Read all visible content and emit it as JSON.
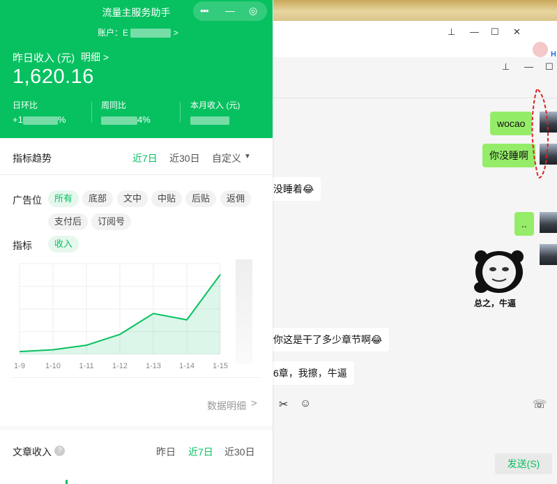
{
  "assistant": {
    "title": "流量主服务助手",
    "capsule": {
      "more": "•••",
      "minimize": "—",
      "close": "◎"
    },
    "account_label": "账户：",
    "account_first_char": "E",
    "chevron": ">",
    "yesterday_income_label": "昨日收入 (元)",
    "detail_link": "明细 >",
    "yesterday_income_value": "1,620.16",
    "stats": [
      {
        "label": "日环比",
        "value_prefix": "+1",
        "value_suffix": "%"
      },
      {
        "label": "周同比",
        "value_prefix": "",
        "value_suffix": "4%"
      },
      {
        "label": "本月收入 (元)",
        "value_prefix": "",
        "value_suffix": ""
      }
    ],
    "trend": {
      "title": "指标趋势",
      "tabs": [
        "近7日",
        "近30日",
        "自定义"
      ],
      "active_tab": "近7日",
      "dropdown_icon": "▼"
    },
    "ad_slot": {
      "label": "广告位",
      "options": [
        "所有",
        "底部",
        "文中",
        "中贴",
        "后贴",
        "返佣",
        "支付后",
        "订阅号"
      ],
      "active": "所有"
    },
    "metric": {
      "label": "指标",
      "options": [
        "收入"
      ],
      "active": "收入"
    },
    "data_detail_link": "数据明细",
    "article_income": {
      "title": "文章收入",
      "help_icon": "?",
      "tabs": [
        "昨日",
        "近7日",
        "近30日"
      ],
      "active_tab": "近7日"
    },
    "accent_color": "#07c160"
  },
  "chart_data": {
    "type": "area",
    "x": [
      "1-9",
      "1-10",
      "1-11",
      "1-12",
      "1-13",
      "1-14",
      "1-15"
    ],
    "series": [
      {
        "values": [
          0.03,
          0.05,
          0.1,
          0.22,
          0.45,
          0.38,
          0.88
        ]
      }
    ],
    "ylim": [
      0,
      1
    ],
    "grid": true,
    "color": "#07c160"
  },
  "chat": {
    "messages": [
      {
        "side": "right",
        "text": "wocao"
      },
      {
        "side": "right",
        "text": "你没睡啊"
      },
      {
        "side": "left",
        "text": "没睡着😂"
      },
      {
        "side": "right",
        "text": ".."
      },
      {
        "side": "right",
        "text": "",
        "sticker": true
      },
      {
        "side": "left",
        "text": "",
        "sticker_caption": "总之，牛逼"
      },
      {
        "side": "left",
        "text": "你这是干了多少章节啊😂"
      },
      {
        "side": "left",
        "text": "6章，我擦，牛逼"
      }
    ],
    "sticker_caption": "总之，牛逼",
    "send_label": "发送(S)",
    "tools": {
      "scissors": "✂",
      "emoji": "☺",
      "phone": "☏"
    },
    "window_controls": {
      "pin": "⊥",
      "minimize": "—",
      "maximize": "☐",
      "close": "✕"
    },
    "side_label": "H"
  }
}
